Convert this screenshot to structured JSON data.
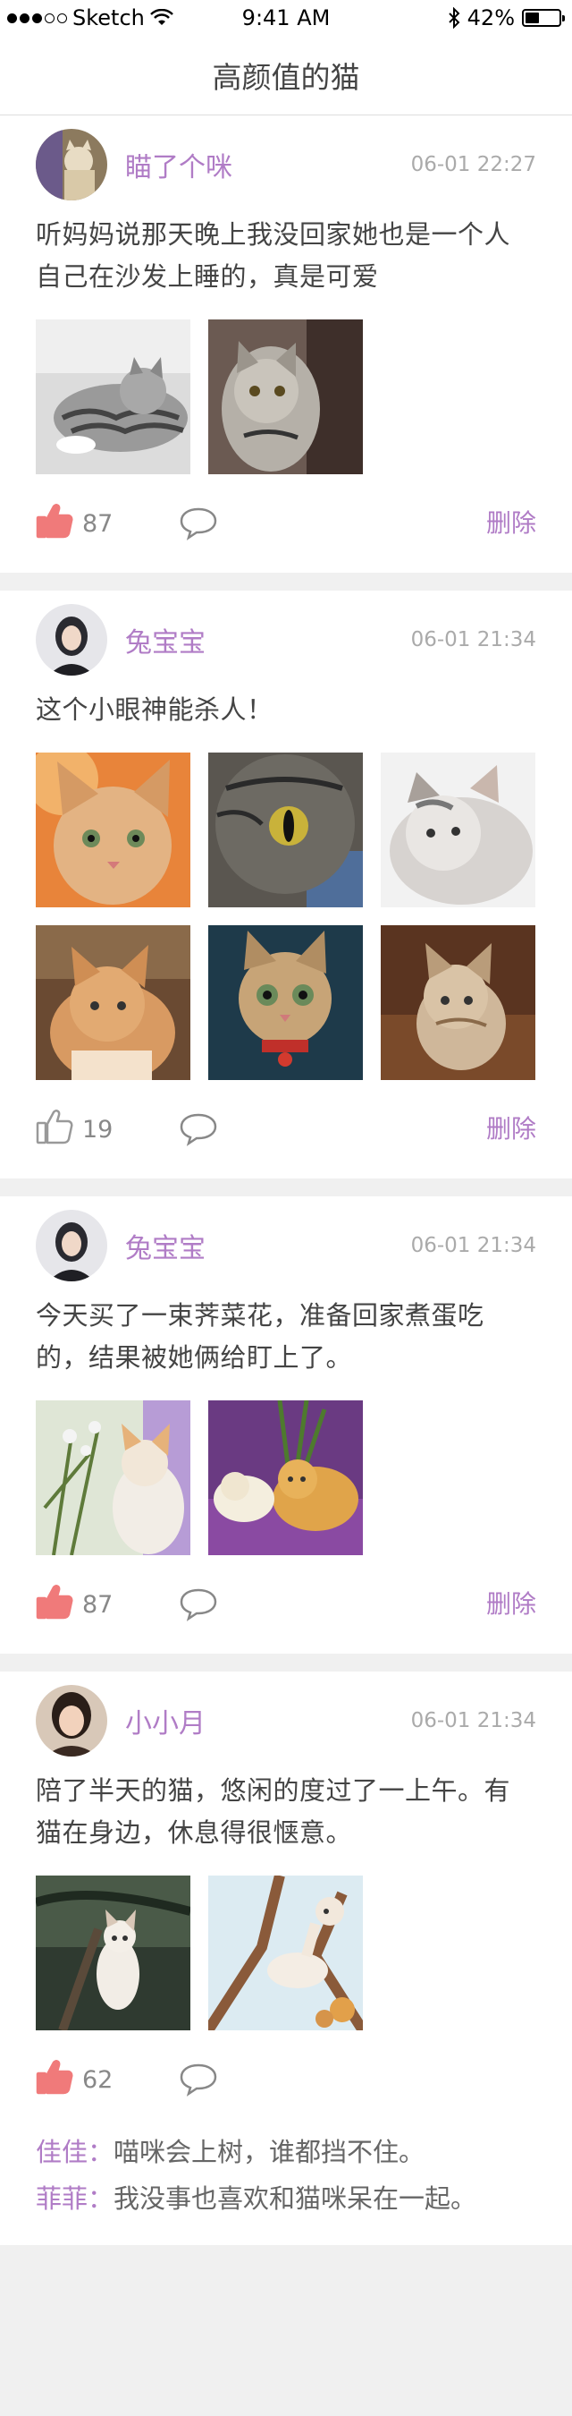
{
  "status": {
    "carrier": "Sketch",
    "time": "9:41 AM",
    "battery": "42%",
    "battery_level": 0.42
  },
  "nav": {
    "title": "高颜值的猫"
  },
  "posts": [
    {
      "user": "瞄了个咪",
      "time": "06-01 22:27",
      "text": "听妈妈说那天晚上我没回家她也是一个人自己在沙发上睡的，真是可爱",
      "likes": "87",
      "liked": true,
      "delete_label": "删除"
    },
    {
      "user": "兔宝宝",
      "time": "06-01 21:34",
      "text": "这个小眼神能杀人！",
      "likes": "19",
      "liked": false,
      "delete_label": "删除"
    },
    {
      "user": "兔宝宝",
      "time": "06-01 21:34",
      "text": "今天买了一束荠菜花，准备回家煮蛋吃的，结果被她俩给盯上了。",
      "likes": "87",
      "liked": true,
      "delete_label": "删除"
    },
    {
      "user": "小小月",
      "time": "06-01 21:34",
      "text": "陪了半天的猫，悠闲的度过了一上午。有猫在身边，休息得很惬意。",
      "likes": "62",
      "liked": true,
      "comments": [
        {
          "name": "佳佳：",
          "text": "喵咪会上树，谁都挡不住。"
        },
        {
          "name": "菲菲：",
          "text": "我没事也喜欢和猫咪呆在一起。"
        }
      ]
    }
  ],
  "colors": {
    "accent": "#b07cc6",
    "like_active": "#f07a7a",
    "like_inactive": "#999999"
  },
  "icons": {
    "like": "thumbs-up-icon",
    "comment": "speech-bubble-icon"
  }
}
